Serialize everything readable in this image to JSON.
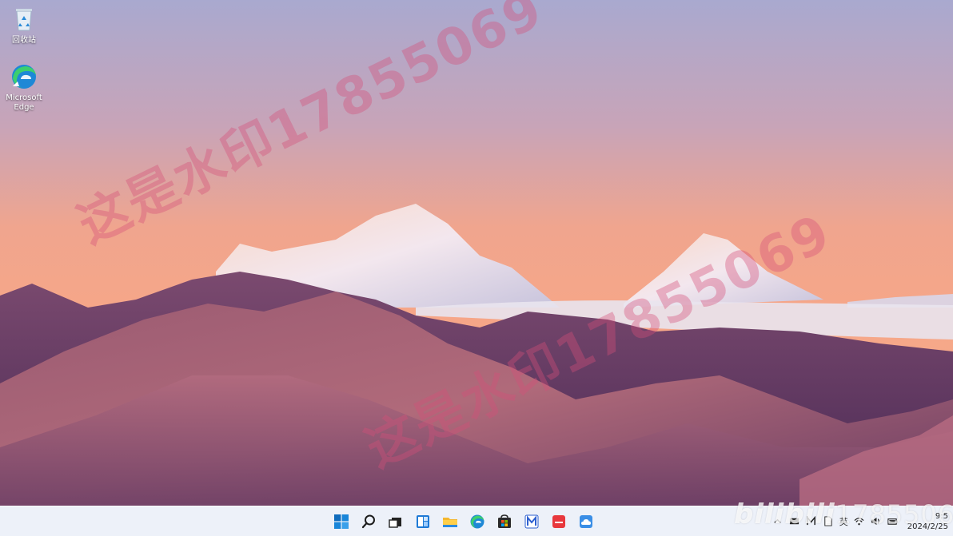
{
  "desktop_icons": [
    {
      "name": "recycle-bin",
      "label": "回收站",
      "icon": "recycle-bin-icon"
    },
    {
      "name": "microsoft-edge",
      "label": "Microsoft Edge",
      "icon": "edge-icon"
    }
  ],
  "watermarks": {
    "primary": "这是水印17855069",
    "secondary": "这是水印17855069"
  },
  "overlay_watermark": {
    "logo": "bilibili",
    "number": "17855069"
  },
  "taskbar": {
    "pinned": [
      {
        "name": "start",
        "icon": "windows-start-icon"
      },
      {
        "name": "search",
        "icon": "search-icon"
      },
      {
        "name": "task-view",
        "icon": "task-view-icon"
      },
      {
        "name": "widgets",
        "icon": "widgets-icon"
      },
      {
        "name": "file-explorer",
        "icon": "folder-icon"
      },
      {
        "name": "edge",
        "icon": "edge-icon"
      },
      {
        "name": "microsoft-store",
        "icon": "store-icon"
      },
      {
        "name": "app-m",
        "icon": "m-app-icon"
      },
      {
        "name": "huawei-app",
        "icon": "huawei-app-icon"
      },
      {
        "name": "cloud-app",
        "icon": "cloud-icon"
      }
    ],
    "tray": {
      "ime": "英",
      "time": "9:5",
      "date": "2024/2/25"
    }
  },
  "colors": {
    "taskbar_bg": "#ecf0f8",
    "watermark": "#d65078",
    "accent_blue": "#0078d4"
  }
}
